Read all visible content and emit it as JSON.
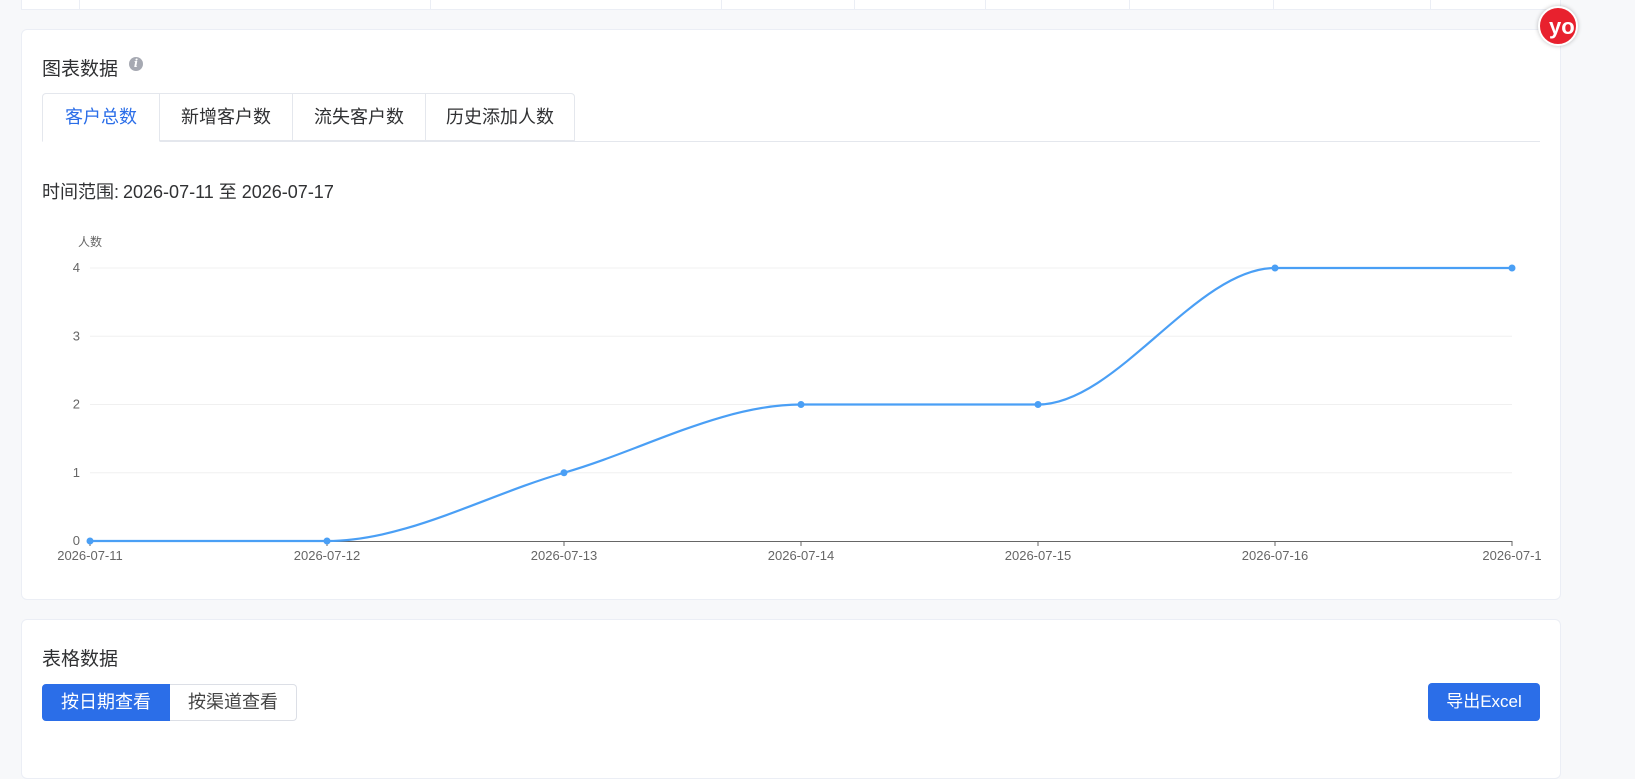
{
  "chart_section": {
    "title": "图表数据",
    "tabs": [
      {
        "label": "客户总数",
        "active": true
      },
      {
        "label": "新增客户数",
        "active": false
      },
      {
        "label": "流失客户数",
        "active": false
      },
      {
        "label": "历史添加人数",
        "active": false
      }
    ],
    "time_range_label": "时间范围:",
    "time_range_value": "2026-07-11 至 2026-07-17"
  },
  "chart_data": {
    "type": "line",
    "ylabel": "人数",
    "x": [
      "2026-07-11",
      "2026-07-12",
      "2026-07-13",
      "2026-07-14",
      "2026-07-15",
      "2026-07-16",
      "2026-07-1"
    ],
    "series": [
      {
        "values": [
          0,
          0,
          1,
          2,
          2,
          4,
          4
        ],
        "color": "#4a9ff5"
      }
    ],
    "yticks": [
      0,
      1,
      2,
      3,
      4
    ],
    "ylim": [
      0,
      4
    ],
    "smooth": true,
    "grid": true
  },
  "table_section": {
    "title": "表格数据",
    "view_buttons": [
      {
        "label": "按日期查看",
        "active": true
      },
      {
        "label": "按渠道查看",
        "active": false
      }
    ],
    "export_label": "导出Excel"
  },
  "float_badge": {
    "text": "yo"
  },
  "colors": {
    "primary": "#2b6ee8",
    "line": "#4a9ff5"
  }
}
